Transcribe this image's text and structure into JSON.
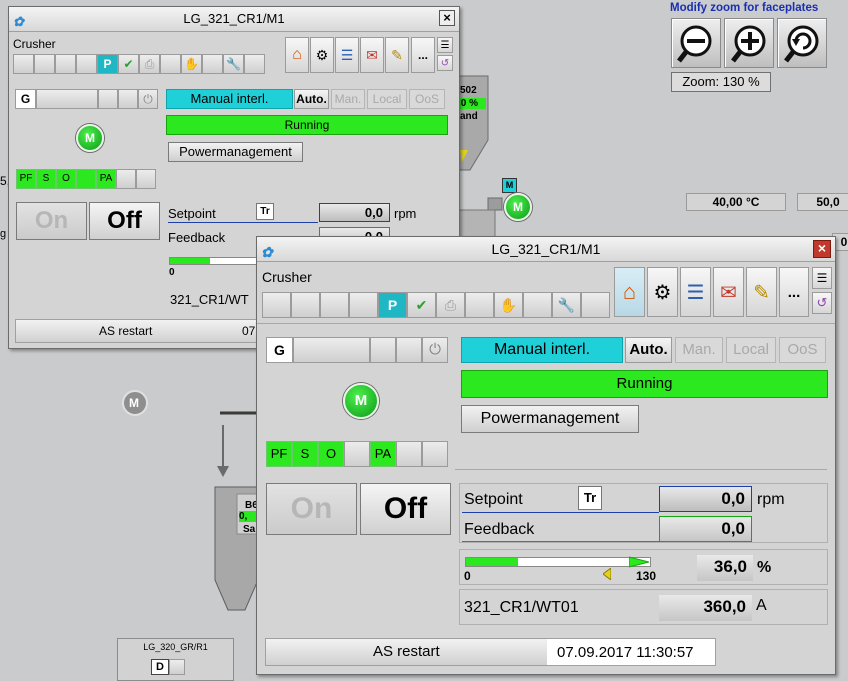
{
  "zoom": {
    "title": "Modify zoom for faceplates",
    "level": "Zoom: 130 %",
    "buttons": [
      "zoom-out",
      "zoom-in",
      "zoom-reset"
    ]
  },
  "background": {
    "temp_value": "40,00 °C",
    "value_right": "50,0",
    "value_right2": "0",
    "motor_label": "M",
    "tag_partial": "502",
    "tag_partial_value": ",0 %",
    "tag_partial_text": "and",
    "left_cut_text": "5,",
    "left_cut_text2": "g",
    "silo_label": "B6",
    "silo_value": "0,",
    "silo_text": "Sa",
    "mini_faceplate_title": "LG_320_GR/R1",
    "mini_faceplate_mode": "D"
  },
  "faceplate_back": {
    "title": "LG_321_CR1/M1",
    "close": "×",
    "name": "Crusher",
    "p_label": "P",
    "more_label": "...",
    "g_label": "G",
    "modes": [
      "Manual interl.",
      "Auto.",
      "Man.",
      "Local",
      "OoS"
    ],
    "running": "Running",
    "powermanagement": "Powermanagement",
    "motor": "M",
    "status": [
      "PF",
      "S",
      "O",
      "",
      "PA",
      "",
      ""
    ],
    "on": "On",
    "off": "Off",
    "setpoint_label": "Setpoint",
    "tr": "Tr",
    "setpoint_value": "0,0",
    "setpoint_unit": "rpm",
    "feedback_label": "Feedback",
    "feedback_value": "0,0",
    "bar_min": "0",
    "tag": "321_CR1/WT",
    "as_restart": "AS restart",
    "date_partial": "07"
  },
  "faceplate_front": {
    "title": "LG_321_CR1/M1",
    "close": "×",
    "name": "Crusher",
    "p_label": "P",
    "more_label": "...",
    "g_label": "G",
    "modes": [
      "Manual interl.",
      "Auto.",
      "Man.",
      "Local",
      "OoS"
    ],
    "running": "Running",
    "powermanagement": "Powermanagement",
    "motor": "M",
    "status": [
      "PF",
      "S",
      "O",
      "",
      "PA",
      "",
      ""
    ],
    "on": "On",
    "off": "Off",
    "setpoint_label": "Setpoint",
    "tr": "Tr",
    "setpoint_value": "0,0",
    "setpoint_unit": "rpm",
    "feedback_label": "Feedback",
    "feedback_value": "0,0",
    "bar_min": "0",
    "bar_max": "130",
    "bar_fill_fraction": 0.28,
    "bar_value": "36,0",
    "bar_unit": "%",
    "tag": "321_CR1/WT01",
    "tag_value": "360,0",
    "tag_unit": "A",
    "as_restart": "AS restart",
    "date": "07.09.2017 11:30:57"
  },
  "colors": {
    "running_green": "#2ce81e",
    "mode_cyan": "#1fd0d8",
    "setpoint_blue": "#1e3fa8",
    "close_red": "#c0392b"
  }
}
